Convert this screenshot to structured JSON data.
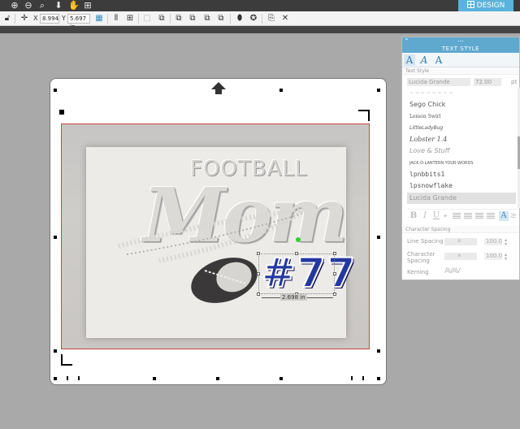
{
  "app": {
    "mode_tab": "DESIGN",
    "top_icons": [
      "zoom-in-icon",
      "zoom-out-icon",
      "zoom-select-icon",
      "pan-down-icon",
      "hand-icon",
      "fit-page-icon"
    ]
  },
  "toolbar": {
    "x_label": "X",
    "x_value": "8.994",
    "y_label": "Y",
    "y_value": "5.697 in"
  },
  "canvas": {
    "headline_word": "FOOTBALL",
    "script_word": "Mom",
    "text_object": "#77",
    "width_readout": "2.698 in"
  },
  "panel": {
    "title": "TEXT STYLE",
    "dots": "...",
    "section_text_style": "Text Style",
    "font_name": "Lucida Grande",
    "font_size": "72.00",
    "font_unit": "pt",
    "fonts": [
      "~ ~ ~ ~ ~ ~ ~ ~",
      "Sego Chick",
      "Lemon Swirl",
      "LittleLadyBug",
      "Lobster 1.4",
      "Love & Stuff",
      "JACK·O·LANTERN·YOUR·WORDS",
      "lpnbbits1",
      "lpsnowflake",
      "Lucida Grande"
    ],
    "selected_font_index": 9,
    "format_bold": "B",
    "format_italic": "I",
    "format_underline": "U",
    "section_char_spacing": "Character Spacing",
    "line_spacing_label": "Line Spacing",
    "line_spacing_value": "100.0",
    "char_spacing_label_1": "Character",
    "char_spacing_label_2": "Spacing",
    "char_spacing_value": "100.0",
    "kerning_label": "Kerning",
    "kerning_sample": "AVAV",
    "percent": "%"
  },
  "colors": {
    "accent": "#5ab2dd",
    "number_fill": "#2338a0",
    "selection_handle": "#33cc33"
  }
}
